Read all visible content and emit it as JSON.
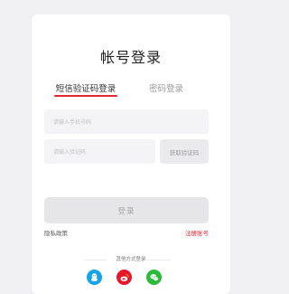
{
  "login": {
    "title": "帐号登录",
    "tabs": [
      {
        "label": "短信验证码登录",
        "active": true
      },
      {
        "label": "密码登录",
        "active": false
      }
    ],
    "phone_placeholder": "请输入手机号码",
    "code_placeholder": "请输入验证码",
    "get_code_label": "获取验证码",
    "submit_label": "登录",
    "privacy_label": "隐私政策",
    "register_label": "注册账号",
    "other_methods_label": "其他方式登录"
  },
  "social_icons": [
    "qq-icon",
    "weibo-icon",
    "wechat-icon"
  ],
  "colors": {
    "accent": "#e02733",
    "qq": "#16a3ea",
    "weibo": "#e6162d",
    "wechat": "#2bbb3b",
    "background": "#f1f1f4",
    "card": "#ffffff"
  }
}
